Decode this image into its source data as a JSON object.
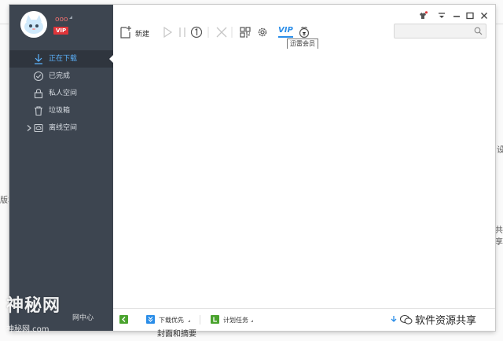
{
  "user": {
    "name": "ooo",
    "vip_badge": "VIP"
  },
  "sidebar": {
    "items": [
      {
        "label": "正在下载",
        "icon": "download-icon",
        "active": true
      },
      {
        "label": "已完成",
        "icon": "check-circle-icon",
        "active": false
      },
      {
        "label": "私人空间",
        "icon": "lock-icon",
        "active": false
      },
      {
        "label": "垃圾箱",
        "icon": "trash-icon",
        "active": false
      },
      {
        "label": "离线空间",
        "icon": "cloud-icon",
        "active": false
      }
    ]
  },
  "toolbar": {
    "new_label": "新建",
    "icons": [
      "new-file-icon",
      "play-icon",
      "pause-icon",
      "speed-limit-icon",
      "delete-icon",
      "grid-icon",
      "settings-icon",
      "vip-icon",
      "gift-icon"
    ],
    "vip_text": "VIP",
    "tooltip": "迅雷会员"
  },
  "statusbar": {
    "priority_label": "下载优先",
    "schedule_label": "计划任务"
  },
  "watermarks": {
    "left_title": "神秘网",
    "left_sub": "神秘网.com",
    "center_text": "网中心",
    "right_text": "软件资源共享"
  },
  "background": {
    "right_fragment_1": "设",
    "left_fragment": "版本",
    "right_fragment_2": "共享",
    "bottom_fragment": "封面和摘要"
  },
  "colors": {
    "sidebar_bg": "#3d4550",
    "active_item_bg": "#2f353e",
    "active_item_text": "#5cb4ff",
    "vip_red": "#e0353a",
    "accent_blue": "#2a8de8",
    "green": "#4aa32e"
  }
}
